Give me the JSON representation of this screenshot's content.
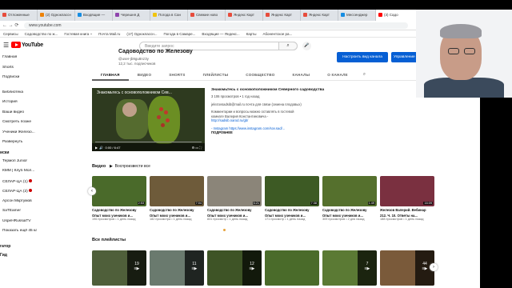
{
  "browser": {
    "tabs": [
      {
        "label": "Отложенные",
        "color": "#e74c3c"
      },
      {
        "label": "(2) Одноклассн",
        "color": "#ee8208"
      },
      {
        "label": "Входящие — ",
        "color": "#168de2"
      },
      {
        "label": "Черешня Д",
        "color": "#8e44ad"
      },
      {
        "label": "Погода в Сан",
        "color": "#f1c40f"
      },
      {
        "label": "Свежие ново",
        "color": "#e74c3c"
      },
      {
        "label": "Яндекс Карт",
        "color": "#e74c3c"
      },
      {
        "label": "Яндекс Карт",
        "color": "#e74c3c"
      },
      {
        "label": "Яндекс Карт",
        "color": "#e74c3c"
      },
      {
        "label": "Мессенджер",
        "color": "#168de2"
      },
      {
        "label": "(3) Садо",
        "color": "#ff0000"
      }
    ],
    "url": "www.youtube.com",
    "bookmarks": [
      "Сервисы",
      "Садоводство по ж...",
      "Гостевая книга ~",
      "Почта Mail.ru",
      "(17) Одноклассн...",
      "Погода в Самаре...",
      "Входящие — Яндекс...",
      "Карты",
      "Абонентское ра..."
    ]
  },
  "youtube": {
    "logo_text": "YouTube",
    "search_placeholder": "Введите запрос",
    "sidebar": {
      "main": [
        "Главная",
        "Shorts",
        "Подписки"
      ],
      "library": [
        "Библиотека",
        "История",
        "Ваши видео",
        "Смотреть позже",
        "Ученики Железо...",
        "Развернуть"
      ],
      "subs_title": "иски",
      "subs": [
        "Термоп Junior",
        "КММ | Клуб Мол...",
        "СЕЛАР-ЦА (1)",
        "СЕЛАР-ЦА (2)",
        "Арсон Мкртумов",
        "SaTEamer",
        "UspeHRussiaTV",
        "Показать ещё 45 ка..."
      ],
      "footer": [
        "гатор",
        "Гид"
      ]
    },
    "channel": {
      "name": "Садоводство по Железову",
      "handle": "@user-jb9gu8nz3y",
      "subs": "12,2 тыс. подписчиков",
      "btn_customize": "Настроить вид канала",
      "btn_manage": "Управление видео"
    },
    "tabs": [
      "ГЛАВНАЯ",
      "ВИДЕО",
      "SHORTS",
      "ПЛЕЙЛИСТЫ",
      "СООБЩЕСТВО",
      "КАНАЛЫ",
      "О КАНАЛЕ"
    ],
    "featured": {
      "overlay_title": "Знакомьтесь с основоположником Сев...",
      "time": "0:00 / 6:47",
      "title": "Знакомьтесь с основоположником Северного садоводства",
      "meta": "3 106 просмотров • 1 год назад",
      "lines": [
        "jelezovsadsib@mail.ru почта для связи (семена плодовых)",
        "",
        "Комментарии и вопросы можно оставлять в гостевой",
        "комнате Валерия Константиновича -",
        "http://sadsib.narod.ru/gb/",
        "",
        "- Instagram https://www.instagram.com/sov.sad/...",
        "ПОДРОБНЕЕ"
      ]
    },
    "videos_title": "Видео",
    "play_all": "Воспроизвести все",
    "videos": [
      {
        "dur": "2:53",
        "title": "Садоводство по Железову",
        "sub": "Опыт моих учеников и...",
        "meta": "196 просмотров • 1 день назад",
        "color": "#4a6a2a"
      },
      {
        "dur": "7:04",
        "title": "Садоводство по Железову",
        "sub": "Опыт моих учеников и...",
        "meta": "182 просмотра • 1 день назад",
        "color": "#6e5b3a"
      },
      {
        "dur": "6:21",
        "title": "Садоводство по Железову",
        "sub": "Опыт моих учеников и...",
        "meta": "831 просмотр • 1 день назад",
        "color": "#8b8579"
      },
      {
        "dur": "7:38",
        "title": "Садоводство по Железову",
        "sub": "Опыт моих учеников и...",
        "meta": "171 просмотр • 1 день назад",
        "color": "#3d5a24"
      },
      {
        "dur": "1:49",
        "title": "Садоводство по Железову",
        "sub": "Опыт моих учеников и...",
        "meta": "309 просмотров • 2 дня назад",
        "color": "#55702d"
      },
      {
        "dur": "16:09",
        "title": "Железов Валерий. Вебинар",
        "sub": "212. Ч. 10. Ответы на...",
        "meta": "188 просмотров • 1 день назад",
        "color": "#7a3040"
      }
    ],
    "playlists_title": "Все плейлисты",
    "playlists": [
      {
        "count": "19",
        "color": "#4f5f3a"
      },
      {
        "count": "11",
        "color": "#6a7a6e"
      },
      {
        "count": "12",
        "color": "#3e5426"
      },
      {
        "count": "",
        "color": "#4a6b2a"
      },
      {
        "count": "7",
        "color": "#5b7a34"
      },
      {
        "count": "44",
        "color": "#7a5a3a"
      }
    ]
  }
}
